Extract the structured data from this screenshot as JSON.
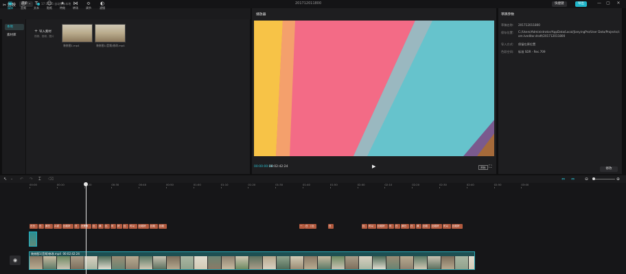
{
  "app": {
    "logo": "✂ 剪映",
    "menu_label": "菜单 ⌄",
    "status": "17:15:35 自动保存本地",
    "project_title": "201712011800"
  },
  "title_actions": {
    "shortcut": "快捷键",
    "export": "导出"
  },
  "window_controls": [
    "—",
    "▢",
    "✕"
  ],
  "toolbar": [
    {
      "label": "媒体",
      "icon": "media-icon",
      "glyph": "▣",
      "active": true
    },
    {
      "label": "音频",
      "icon": "audio-icon",
      "glyph": "◷",
      "active": false
    },
    {
      "label": "文本",
      "icon": "text-icon",
      "glyph": "T",
      "active": false
    },
    {
      "label": "贴纸",
      "icon": "sticker-icon",
      "glyph": "☺",
      "active": false
    },
    {
      "label": "特效",
      "icon": "effects-icon",
      "glyph": "✦",
      "active": false
    },
    {
      "label": "转场",
      "icon": "transition-icon",
      "glyph": "⋈",
      "active": false
    },
    {
      "label": "调节",
      "icon": "adjust-icon",
      "glyph": "≎",
      "active": false
    },
    {
      "label": "滤镜",
      "icon": "filter-icon",
      "glyph": "◐",
      "active": false
    }
  ],
  "media_nav": {
    "local": "本地",
    "library": "素材库"
  },
  "import": {
    "label": "导入素材",
    "hint": "视频、音频、图片"
  },
  "media_items": [
    {
      "caption": "装修图1.mp4"
    },
    {
      "caption": "装修图1(音频)修改.mp4"
    }
  ],
  "player": {
    "title": "播放器",
    "current_time": "00:00:00:28",
    "total_time": "00:02:42:24",
    "ratio_button": "原始"
  },
  "attributes": {
    "title": "草稿参数",
    "rows": [
      {
        "key": "草稿名称:",
        "value": "201712011800"
      },
      {
        "key": "保存位置:",
        "value": "C:/Users/Administrator/AppData/Local/JianyingPro/User Data/Projects/com.lveditor.draft/201712011800"
      },
      {
        "key": "导入方式:",
        "value": "保留在原位置"
      },
      {
        "key": "色彩空间:",
        "value": "标准 SDR - Rec.709"
      }
    ],
    "modify_button": "修改"
  },
  "timeline": {
    "ticks": [
      "00:00",
      "00:10",
      "00:20",
      "00:30",
      "00:40",
      "00:50",
      "01:00",
      "01:10",
      "01:20",
      "01:30",
      "01:40",
      "01:50",
      "02:00",
      "02:10",
      "02:20",
      "02:30",
      "02:40",
      "02:50",
      "03:00"
    ],
    "subtitle_clips": [
      "日日",
      "日",
      "我日",
      "ル说",
      "比较好",
      "日",
      "还是有",
      "比",
      "我",
      "比",
      "可",
      "好",
      "比",
      "可以",
      "比较好",
      "比较",
      "比较",
      "一",
      "可以",
      "日",
      "比",
      "日",
      "比",
      "可以",
      "比较好",
      "可",
      "日",
      "我日",
      "日",
      "我",
      "比较",
      "比较好",
      "可以",
      "比较好"
    ],
    "main_track_label": "装修图1(音频)修改.mp4",
    "main_track_duration": "00:02:42:24"
  }
}
